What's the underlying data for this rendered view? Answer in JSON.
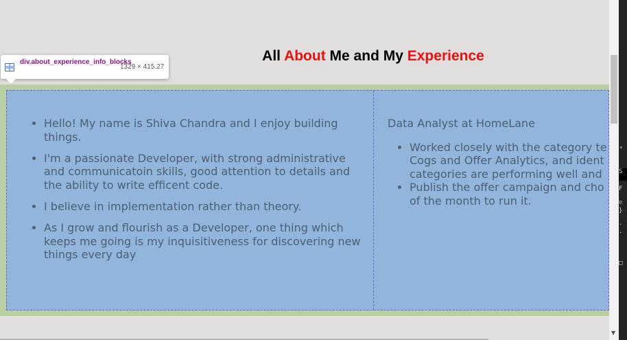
{
  "heading": {
    "part1": "All ",
    "part2": "About",
    "part3": " Me and My ",
    "part4": "Experience"
  },
  "colors": {
    "accent": "#ee0e0e",
    "green_band": "#b8cfa1",
    "block_blue": "#92b5dc",
    "text_gray": "#4d5f72",
    "dashed_border": "#7a5ad8"
  },
  "about_list": [
    "Hello! My name is Shiva Chandra and I enjoy building things.",
    "I'm a passionate Developer, with strong administrative and communicatoin skills, good attention to details and the ability to write efficent code.",
    "I believe in implementation rather than theory.",
    "As I grow and flourish as a Developer, one thing which keeps me going is my inquisitiveness for discovering new things every day"
  ],
  "experience": {
    "title": "Data Analyst at HomeLane",
    "line1a": "Worked closely with the category te",
    "line1b": "Cogs and Offer Analytics, and ident",
    "line1c": "categories are performing well and",
    "line2a": "Publish the offer campaign and cho",
    "line2b": "of the month to run it."
  },
  "tooltip": {
    "element_name": "div.about_experience_info_blocks",
    "size": "1329 × 415.27",
    "icon": "flex-container-icon"
  }
}
